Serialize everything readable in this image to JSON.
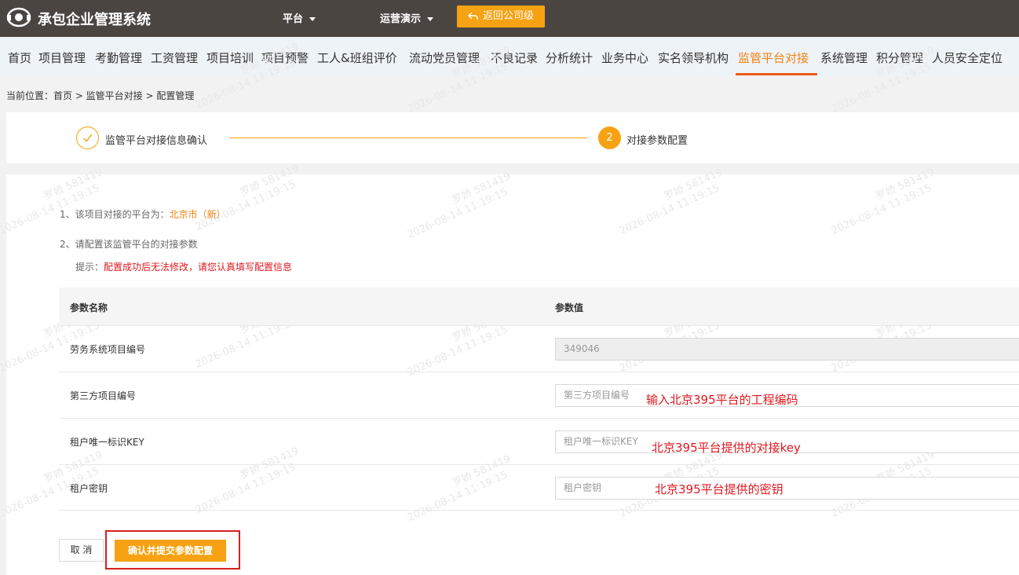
{
  "app": {
    "title": "承包企业管理系统"
  },
  "topbar": {
    "platform_menu": "平台",
    "demo_menu": "运营演示",
    "return_button": "返回公司级"
  },
  "nav": {
    "items": [
      "首页",
      "项目管理",
      "考勤管理",
      "工资管理",
      "项目培训",
      "项目预警",
      "工人&班组评价",
      "流动党员管理",
      "不良记录",
      "分析统计",
      "业务中心",
      "实名领导机构",
      "监管平台对接",
      "系统管理",
      "积分管理",
      "人员安全定位"
    ],
    "active": "监管平台对接"
  },
  "breadcrumb": {
    "text": "当前位置：首页 > 监管平台对接 > 配置管理"
  },
  "steps": {
    "step1": "监管平台对接信息确认",
    "step2_number": "2",
    "step2": "对接参数配置"
  },
  "info": {
    "line1_prefix": "1、该项目对接的平台为：",
    "line1_platform": "北京市（新）",
    "line2": "2、请配置该监管平台的对接参数",
    "tip_prefix": "提示：",
    "tip_warning": "配置成功后无法修改，请您认真填写配置信息"
  },
  "table": {
    "header_name": "参数名称",
    "header_value": "参数值",
    "rows": [
      {
        "label": "劳务系统项目编号",
        "value": "349046",
        "placeholder": ""
      },
      {
        "label": "第三方项目编号",
        "value": "",
        "placeholder": "第三方项目编号"
      },
      {
        "label": "租户唯一标识KEY",
        "value": "",
        "placeholder": "租户唯一标识KEY"
      },
      {
        "label": "租户密钥",
        "value": "",
        "placeholder": "租户密钥"
      }
    ]
  },
  "annotations": {
    "row2": "输入北京395平台的工程编码",
    "row3": "北京395平台提供的对接key",
    "row4": "北京395平台提供的密钥"
  },
  "actions": {
    "cancel": "取 消",
    "submit": "确认并提交参数配置"
  },
  "watermark": {
    "name": "罗娇 581419",
    "time": "2026-08-14 11:19:15"
  },
  "colors": {
    "accent": "#f6a212",
    "active_nav": "#f08313",
    "warning": "#e0181f",
    "topbar": "#4b4542"
  }
}
